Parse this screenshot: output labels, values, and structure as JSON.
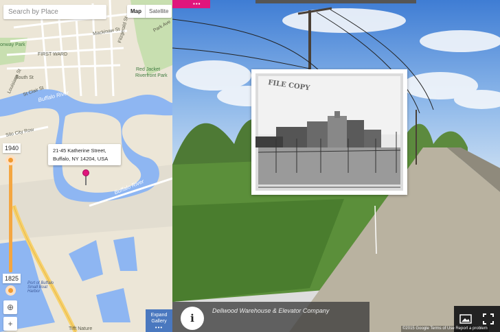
{
  "map": {
    "search_placeholder": "Search by Place",
    "maptype_map": "Map",
    "maptype_satellite": "Satellite",
    "labels": {
      "first_ward": "FIRST WARD",
      "buffalo_river_1": "Buffalo River",
      "buffalo_river_2": "Buffalo River",
      "red_jacket_park": "Red Jacket",
      "red_jacket_park_2": "Riverfront Park",
      "mackinaw": "Mackinaw St",
      "fitzgerald": "Fitzgerald St",
      "park_ave": "Park Ave",
      "south_st": "South St",
      "louisiana": "Louisiana St",
      "st_clair": "St Clair St",
      "silo_city": "Silo City Row",
      "conway_park": "onway Park",
      "small_boat": "Port of Buffalo Small Boat Harbor",
      "tifft": "Tifft Nature"
    },
    "popup_line1": "21-45 Katherine Street,",
    "popup_line2": "Buffalo, NY 14204, USA",
    "year_top": "1940",
    "year_bottom": "1825",
    "zoom_in": "+",
    "locate_icon": "crosshair-icon"
  },
  "street": {
    "topbar_icon": "grid-icon",
    "photo_stamp": "FILE COPY",
    "caption": "Dellwood Warehouse & Elevator Company",
    "info_label": "i",
    "gallery_line1": "Expand",
    "gallery_line2": "Gallery",
    "gallery_dots": "•••",
    "attribution": "©2015 Google  Terms of Use  Report a problem",
    "image_icon": "image-icon",
    "fullscreen_icon": "fullscreen-icon"
  }
}
